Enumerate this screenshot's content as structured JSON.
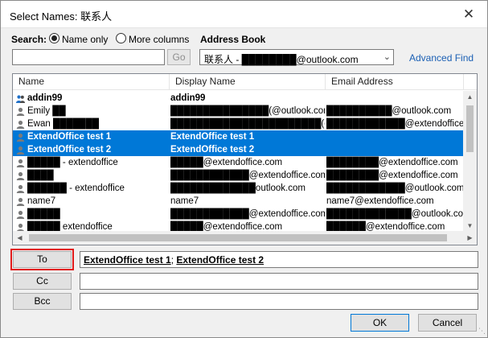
{
  "window": {
    "title": "Select Names: 联系人",
    "close_glyph": "✕"
  },
  "search": {
    "label": "Search:",
    "option_name_only": "Name only",
    "option_more_columns": "More columns",
    "query": "",
    "go_label": "Go"
  },
  "address_book": {
    "label": "Address Book",
    "selected": "联系人 - ████████@outlook.com",
    "advanced_find": "Advanced Find"
  },
  "list": {
    "columns": [
      "Name",
      "Display Name",
      "Email Address"
    ],
    "rows": [
      {
        "name": "addin99",
        "display": "addin99",
        "email": "",
        "icon": "group-icon"
      },
      {
        "name": "Emily ██",
        "display": "███████████████(@outlook.com)",
        "email": "██████████@outlook.com",
        "icon": "contact-icon"
      },
      {
        "name": "Ewan ███████",
        "display": "███████████████████████(exten",
        "email": "████████████@extendoffice.com",
        "icon": "contact-icon"
      },
      {
        "name": "ExtendOffice test 1",
        "display": "ExtendOffice test 1",
        "email": "",
        "icon": "contact-icon"
      },
      {
        "name": "ExtendOffice test 2",
        "display": "ExtendOffice test 2",
        "email": "",
        "icon": "contact-icon"
      },
      {
        "name": "█████ - extendoffice",
        "display": "█████@extendoffice.com",
        "email": "████████@extendoffice.com",
        "icon": "contact-icon"
      },
      {
        "name": "████",
        "display": "████████████@extendoffice.com",
        "email": "████████@extendoffice.com",
        "icon": "contact-icon"
      },
      {
        "name": "██████ - extendoffice",
        "display": "█████████████outlook.com",
        "email": "████████████@outlook.com",
        "icon": "contact-icon"
      },
      {
        "name": "name7",
        "display": "name7",
        "email": "name7@extendoffice.com",
        "icon": "contact-icon"
      },
      {
        "name": "█████",
        "display": "████████████@extendoffice.com)",
        "email": "█████████████@outlook.com",
        "icon": "contact-icon"
      },
      {
        "name": "█████ extendoffice",
        "display": "█████@extendoffice.com",
        "email": "██████@extendoffice.com",
        "icon": "contact-icon"
      }
    ],
    "selected_rows": [
      3,
      4
    ],
    "bold_rows": [
      0
    ]
  },
  "recipients": {
    "to_label": "To",
    "cc_label": "Cc",
    "bcc_label": "Bcc",
    "to_names": [
      "ExtendOffice test 1",
      "ExtendOffice test 2"
    ],
    "to_separator": "; ",
    "cc_value": "",
    "bcc_value": ""
  },
  "footer": {
    "ok_label": "OK",
    "cancel_label": "Cancel"
  }
}
